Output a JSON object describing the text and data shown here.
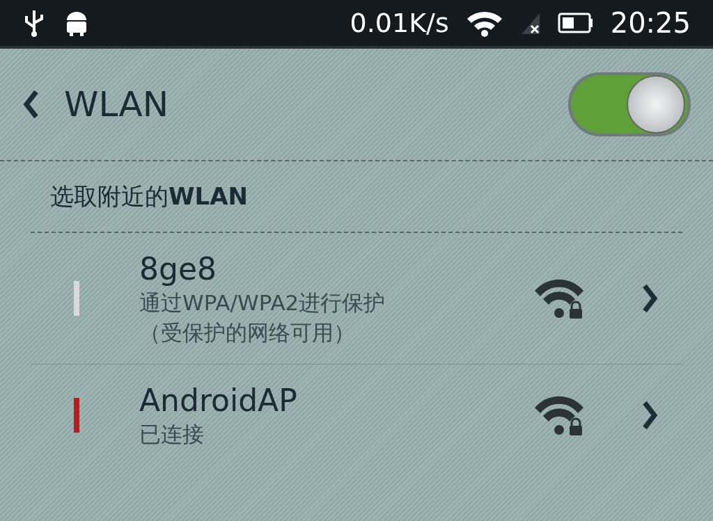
{
  "status_bar": {
    "speed": "0.01K/s",
    "time": "20:25"
  },
  "header": {
    "title": "WLAN",
    "toggle": {
      "on": true
    }
  },
  "section": {
    "title": "选取附近的**WLAN**"
  },
  "networks": [
    {
      "name": "8ge8",
      "details": [
        "通过WPA/WPA2进行保护",
        "（受保护的网络可用）"
      ],
      "color": "#d9d9d9"
    },
    {
      "name": "AndroidAP",
      "details": [
        "已连接"
      ],
      "color": "#b02020"
    }
  ]
}
